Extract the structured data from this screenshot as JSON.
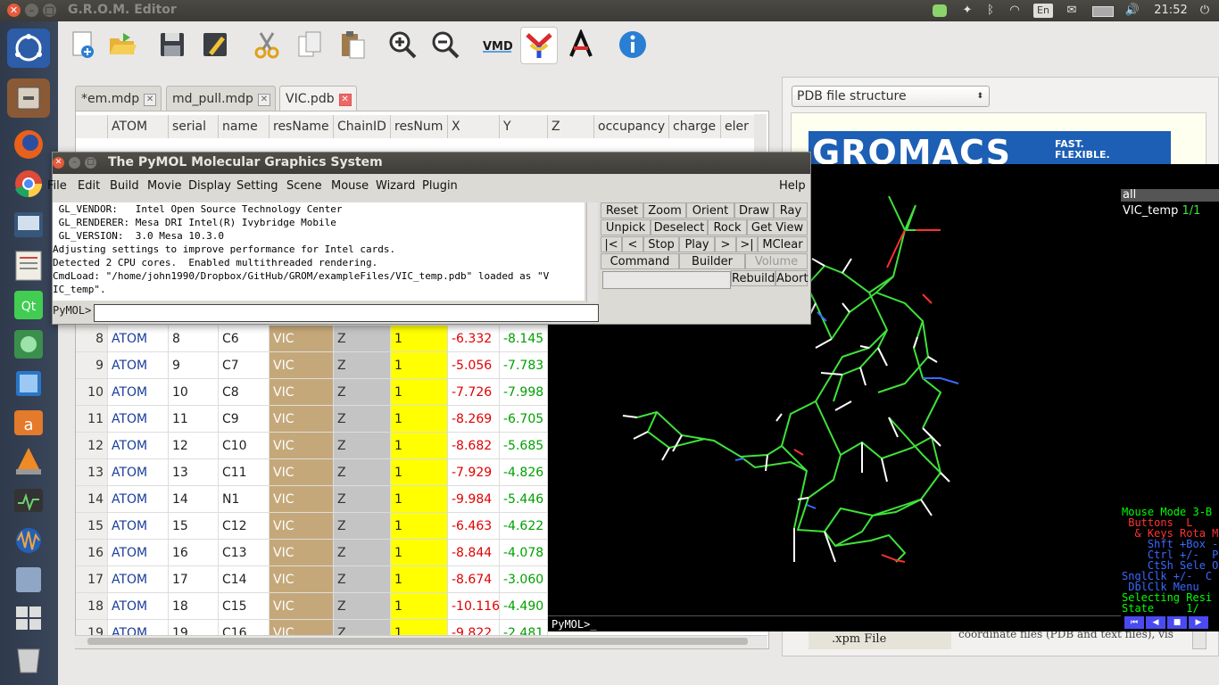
{
  "window_title": "G.R.O.M. Editor",
  "top_panel": {
    "keyboard_layout": "En",
    "clock": "21:52"
  },
  "toolbar": {
    "buttons": [
      "new",
      "open",
      "save",
      "edit",
      "cut",
      "copy",
      "paste",
      "zoom-in",
      "zoom-out",
      "vmd",
      "yasara",
      "avogadro",
      "info"
    ]
  },
  "tabs": [
    {
      "label": "*em.mdp",
      "active": false
    },
    {
      "label": "md_pull.mdp",
      "active": false
    },
    {
      "label": "VIC.pdb",
      "active": true
    }
  ],
  "table": {
    "headers": [
      "",
      "ATOM",
      "serial",
      "name",
      "resName",
      "ChainID",
      "resNum",
      "X",
      "Y",
      "Z",
      "occupancy",
      "charge",
      "eler"
    ],
    "rows": [
      {
        "idx": "8",
        "atom": "ATOM",
        "serial": "8",
        "name": "C6",
        "res": "VIC",
        "chain": "Z",
        "resnum": "1",
        "x": "-6.332",
        "y": "-8.145"
      },
      {
        "idx": "9",
        "atom": "ATOM",
        "serial": "9",
        "name": "C7",
        "res": "VIC",
        "chain": "Z",
        "resnum": "1",
        "x": "-5.056",
        "y": "-7.783"
      },
      {
        "idx": "10",
        "atom": "ATOM",
        "serial": "10",
        "name": "C8",
        "res": "VIC",
        "chain": "Z",
        "resnum": "1",
        "x": "-7.726",
        "y": "-7.998"
      },
      {
        "idx": "11",
        "atom": "ATOM",
        "serial": "11",
        "name": "C9",
        "res": "VIC",
        "chain": "Z",
        "resnum": "1",
        "x": "-8.269",
        "y": "-6.705"
      },
      {
        "idx": "12",
        "atom": "ATOM",
        "serial": "12",
        "name": "C10",
        "res": "VIC",
        "chain": "Z",
        "resnum": "1",
        "x": "-8.682",
        "y": "-5.685"
      },
      {
        "idx": "13",
        "atom": "ATOM",
        "serial": "13",
        "name": "C11",
        "res": "VIC",
        "chain": "Z",
        "resnum": "1",
        "x": "-7.929",
        "y": "-4.826"
      },
      {
        "idx": "14",
        "atom": "ATOM",
        "serial": "14",
        "name": "N1",
        "res": "VIC",
        "chain": "Z",
        "resnum": "1",
        "x": "-9.984",
        "y": "-5.446"
      },
      {
        "idx": "15",
        "atom": "ATOM",
        "serial": "15",
        "name": "C12",
        "res": "VIC",
        "chain": "Z",
        "resnum": "1",
        "x": "-6.463",
        "y": "-4.622"
      },
      {
        "idx": "16",
        "atom": "ATOM",
        "serial": "16",
        "name": "C13",
        "res": "VIC",
        "chain": "Z",
        "resnum": "1",
        "x": "-8.844",
        "y": "-4.078"
      },
      {
        "idx": "17",
        "atom": "ATOM",
        "serial": "17",
        "name": "C14",
        "res": "VIC",
        "chain": "Z",
        "resnum": "1",
        "x": "-8.674",
        "y": "-3.060"
      },
      {
        "idx": "18",
        "atom": "ATOM",
        "serial": "18",
        "name": "C15",
        "res": "VIC",
        "chain": "Z",
        "resnum": "1",
        "x": "-10.116",
        "y": "-4.490"
      },
      {
        "idx": "19",
        "atom": "ATOM",
        "serial": "19",
        "name": "C16",
        "res": "VIC",
        "chain": "Z",
        "resnum": "1",
        "x": "-9.822",
        "y": "-2.481"
      }
    ]
  },
  "right_panel": {
    "select_value": "PDB file structure",
    "banner_text": "GROMACS",
    "banner_sub1": "FAST.",
    "banner_sub2": "FLEXIBLE.",
    "xpm_label": ".xpm File",
    "coord_text": "coordinate files (PDB and text files), vis"
  },
  "pymol": {
    "title": "The PyMOL Molecular Graphics System",
    "menu": [
      "File",
      "Edit",
      "Build",
      "Movie",
      "Display",
      "Setting",
      "Scene",
      "Mouse",
      "Wizard",
      "Plugin",
      "Help"
    ],
    "log_lines": [
      " GL_VENDOR:   Intel Open Source Technology Center",
      " GL_RENDERER: Mesa DRI Intel(R) Ivybridge Mobile",
      " GL_VERSION:  3.0 Mesa 10.3.0",
      "Adjusting settings to improve performance for Intel cards.",
      "Detected 2 CPU cores.  Enabled multithreaded rendering.",
      "CmdLoad: \"/home/john1990/Dropbox/GitHub/GROM/exampleFiles/VIC_temp.pdb\" loaded as \"V",
      "IC_temp\"."
    ],
    "prompt": "PyMOL>",
    "buttons_row1": [
      "Reset",
      "Zoom",
      "Orient",
      "Draw",
      "Ray"
    ],
    "buttons_row2": [
      "Unpick",
      "Deselect",
      "Rock",
      "Get View"
    ],
    "buttons_row3": [
      "|<",
      "<",
      "Stop",
      "Play",
      ">",
      ">|",
      "MClear"
    ],
    "buttons_row4": [
      "Command",
      "Builder",
      "Volume"
    ],
    "buttons_row5": [
      "Rebuild",
      "Abort"
    ],
    "objects": {
      "all": "all",
      "vic": "VIC_temp",
      "vic_state": "1/1"
    },
    "mouse_mode_lines": [
      {
        "text": "Mouse Mode 3-B",
        "color": "#00ff00"
      },
      {
        "text": " Buttons  L   ",
        "color": "#ff3333"
      },
      {
        "text": "  & Keys Rota M",
        "color": "#ff3333"
      },
      {
        "text": "    Shft +Box -",
        "color": "#3a6aff"
      },
      {
        "text": "    Ctrl +/-  P",
        "color": "#3a6aff"
      },
      {
        "text": "    CtSh Sele O",
        "color": "#3a6aff"
      },
      {
        "text": "SnglClk +/-  C",
        "color": "#3a6aff"
      },
      {
        "text": " DblClk Menu  ",
        "color": "#3a6aff"
      },
      {
        "text": "Selecting Resi",
        "color": "#00ff00"
      },
      {
        "text": "State     1/",
        "color": "#00ff00"
      }
    ],
    "viewer_prompt": "PyMOL>_"
  },
  "colors": {
    "accent": "#f07746",
    "resname_bg": "#c5a87a",
    "resnum_bg": "#ffff00",
    "x_color": "#e00000",
    "y_color": "#00a000"
  }
}
